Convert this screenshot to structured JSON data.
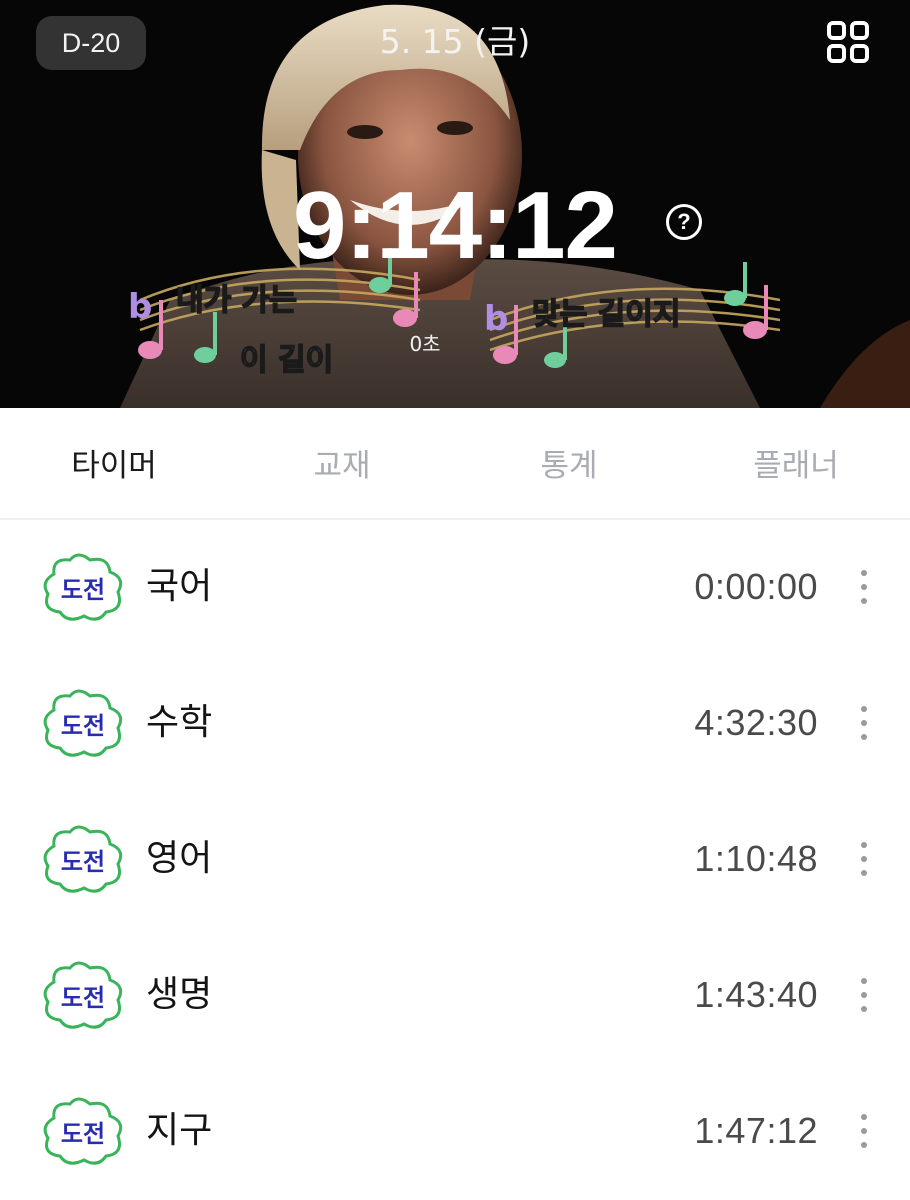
{
  "header": {
    "dday": "D-20",
    "date": "5. 15 (금)",
    "clock": "9:14:12",
    "help_glyph": "?",
    "seconds_label": "0초",
    "menu_icon": "grid-icon",
    "banner_caption_left_top": "내가 가는",
    "banner_caption_left_bottom": "이 길이",
    "banner_caption_right": "맞는 길이지"
  },
  "tabs": [
    {
      "label": "타이머",
      "active": true
    },
    {
      "label": "교재",
      "active": false
    },
    {
      "label": "통계",
      "active": false
    },
    {
      "label": "플래너",
      "active": false
    }
  ],
  "subjects": [
    {
      "badge": "도전",
      "name": "국어",
      "time": "0:00:00"
    },
    {
      "badge": "도전",
      "name": "수학",
      "time": "4:32:30"
    },
    {
      "badge": "도전",
      "name": "영어",
      "time": "1:10:48"
    },
    {
      "badge": "도전",
      "name": "생명",
      "time": "1:43:40"
    },
    {
      "badge": "도전",
      "name": "지구",
      "time": "1:47:12"
    }
  ],
  "colors": {
    "active_tab": "#1a1a1a",
    "inactive_tab": "#a9acb3",
    "badge_text": "#2a2bb0",
    "badge_border": "#3ab35a"
  }
}
